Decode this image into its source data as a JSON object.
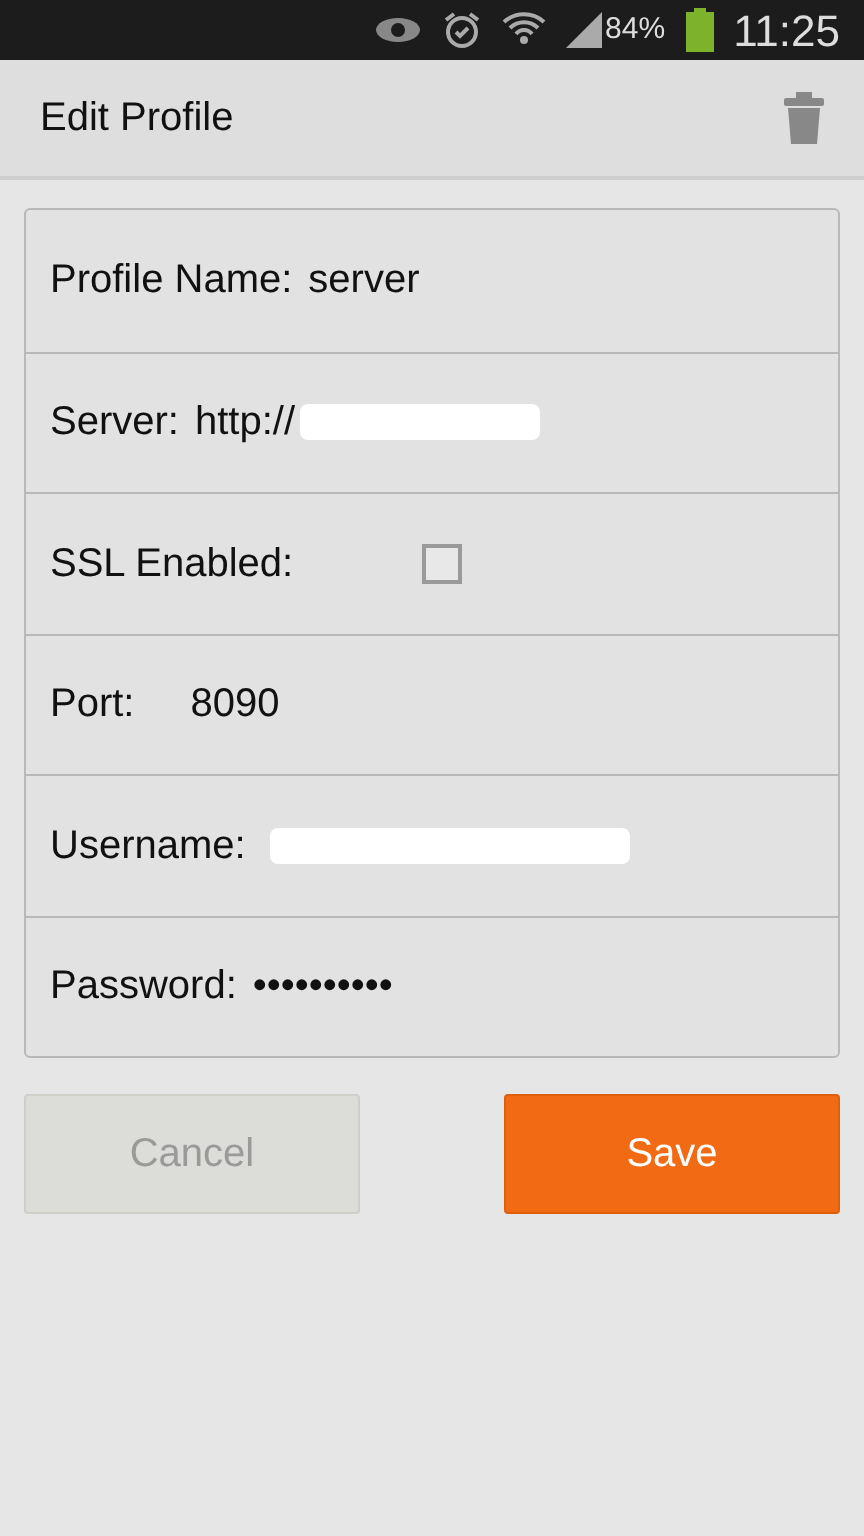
{
  "status_bar": {
    "battery": "84%",
    "time": "11:25"
  },
  "title_bar": {
    "title": "Edit Profile"
  },
  "fields": [
    {
      "kind": "text",
      "label": "Profile Name:",
      "value": "server"
    },
    {
      "kind": "text",
      "label": "Server:",
      "value": "http://",
      "redacted": true
    },
    {
      "kind": "checkbox",
      "label": "SSL Enabled:",
      "checked": false
    },
    {
      "kind": "text",
      "label": "Port:",
      "value": "8090"
    },
    {
      "kind": "text",
      "label": "Username:",
      "redacted": true
    },
    {
      "kind": "text",
      "label": "Password:",
      "value": "••••••••••"
    }
  ],
  "buttons": [
    {
      "label": "Cancel",
      "kind": "secondary"
    },
    {
      "label": "Save",
      "kind": "primary"
    }
  ]
}
